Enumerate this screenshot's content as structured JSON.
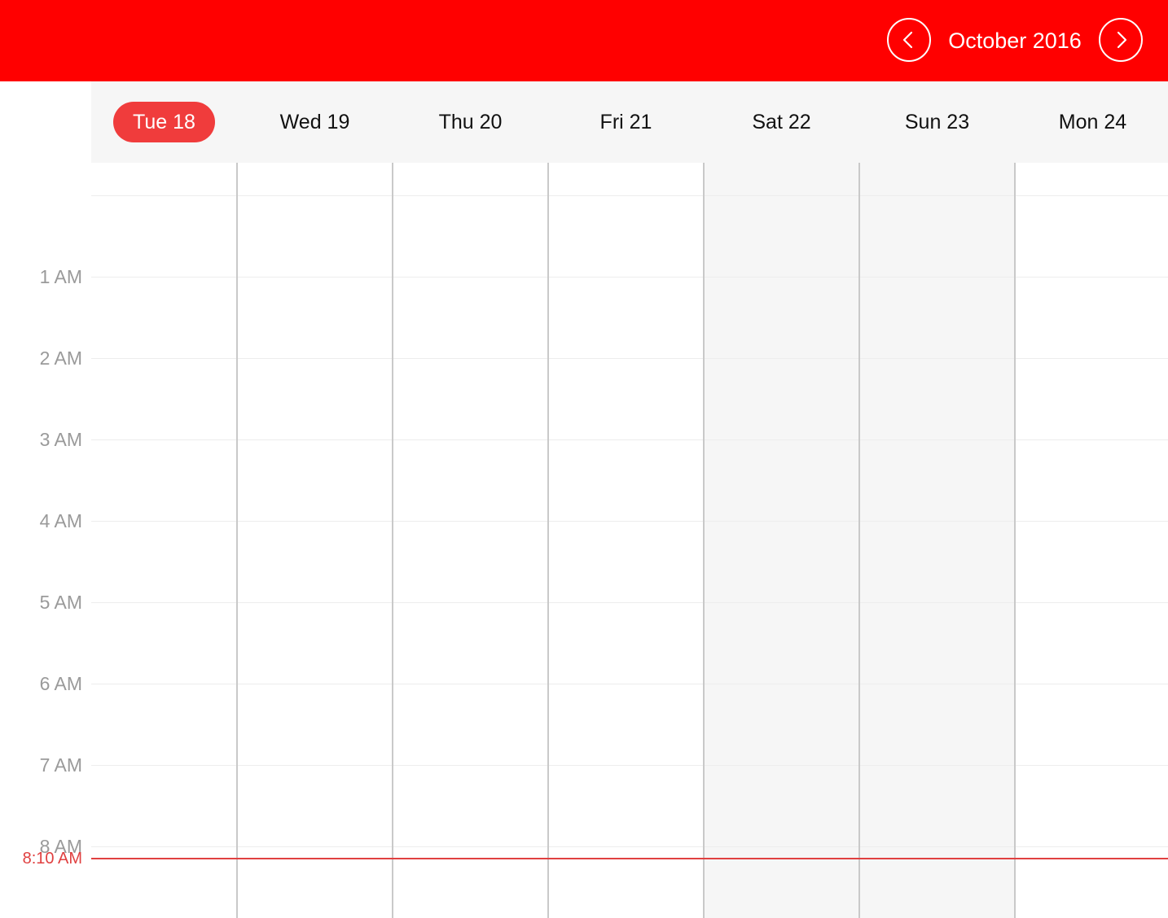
{
  "header": {
    "month_title": "October 2016",
    "prev_icon": "chevron-left-icon",
    "next_icon": "chevron-right-icon"
  },
  "days": [
    {
      "label": "Tue 18",
      "today": true,
      "weekend": false
    },
    {
      "label": "Wed 19",
      "today": false,
      "weekend": false
    },
    {
      "label": "Thu 20",
      "today": false,
      "weekend": false
    },
    {
      "label": "Fri 21",
      "today": false,
      "weekend": false
    },
    {
      "label": "Sat 22",
      "today": false,
      "weekend": true
    },
    {
      "label": "Sun 23",
      "today": false,
      "weekend": true
    },
    {
      "label": "Mon 24",
      "today": false,
      "weekend": false
    }
  ],
  "hours": [
    "1 AM",
    "2 AM",
    "3 AM",
    "4 AM",
    "5 AM",
    "6 AM",
    "7 AM",
    "8 AM"
  ],
  "current_time": {
    "label": "8:10 AM"
  },
  "colors": {
    "header_bg": "#ff0000",
    "today_badge": "#f03c3c",
    "now_line": "#e04040",
    "weekend_bg": "#f6f6f6"
  }
}
